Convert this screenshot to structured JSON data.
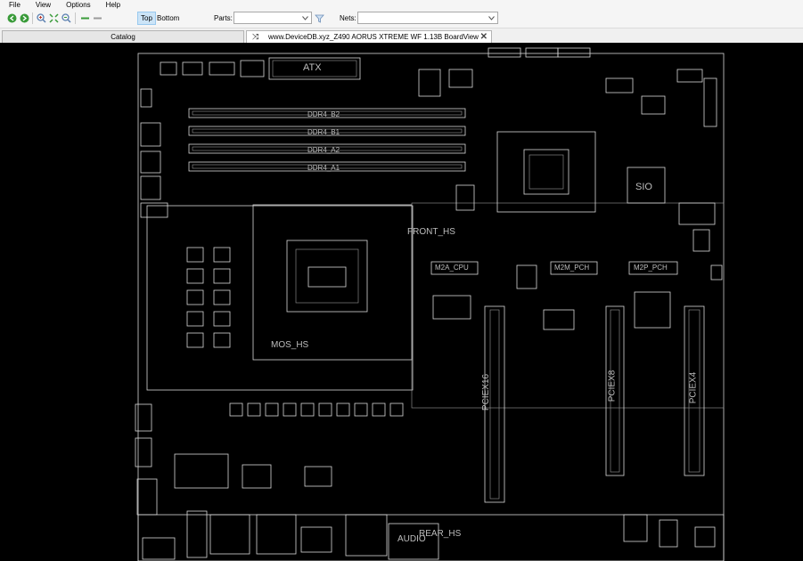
{
  "menu": [
    "File",
    "View",
    "Options",
    "Help"
  ],
  "toolbar": {
    "top_label": "Top",
    "bottom_label": "Bottom",
    "parts_label": "Parts:",
    "nets_label": "Nets:",
    "parts_value": "",
    "nets_value": ""
  },
  "tabs": {
    "catalog": "Catalog",
    "file": "www.DeviceDB.xyz_Z490 AORUS XTREME WF 1.13B BoardView"
  },
  "board": {
    "atx": "ATX",
    "ddr_b2": "DDR4_B2",
    "ddr_b1": "DDR4_B1",
    "ddr_a2": "DDR4_A2",
    "ddr_a1": "DDR4_A1",
    "front_hs": "FRONT_HS",
    "mos_hs": "MOS_HS",
    "sio": "SIO",
    "m2a_cpu": "M2A_CPU",
    "m2m_pch": "M2M_PCH",
    "m2p_pch": "M2P_PCH",
    "pciex16": "PCIEX16",
    "pciex8": "PCIEX8",
    "pciex4": "PCIEX4",
    "audio": "AUDIO",
    "rear_hs": "REAR_HS"
  },
  "colors": {
    "canvas": "#000000",
    "silkscreen": "#d8d8d8",
    "active_layer": "#cce4f7"
  }
}
